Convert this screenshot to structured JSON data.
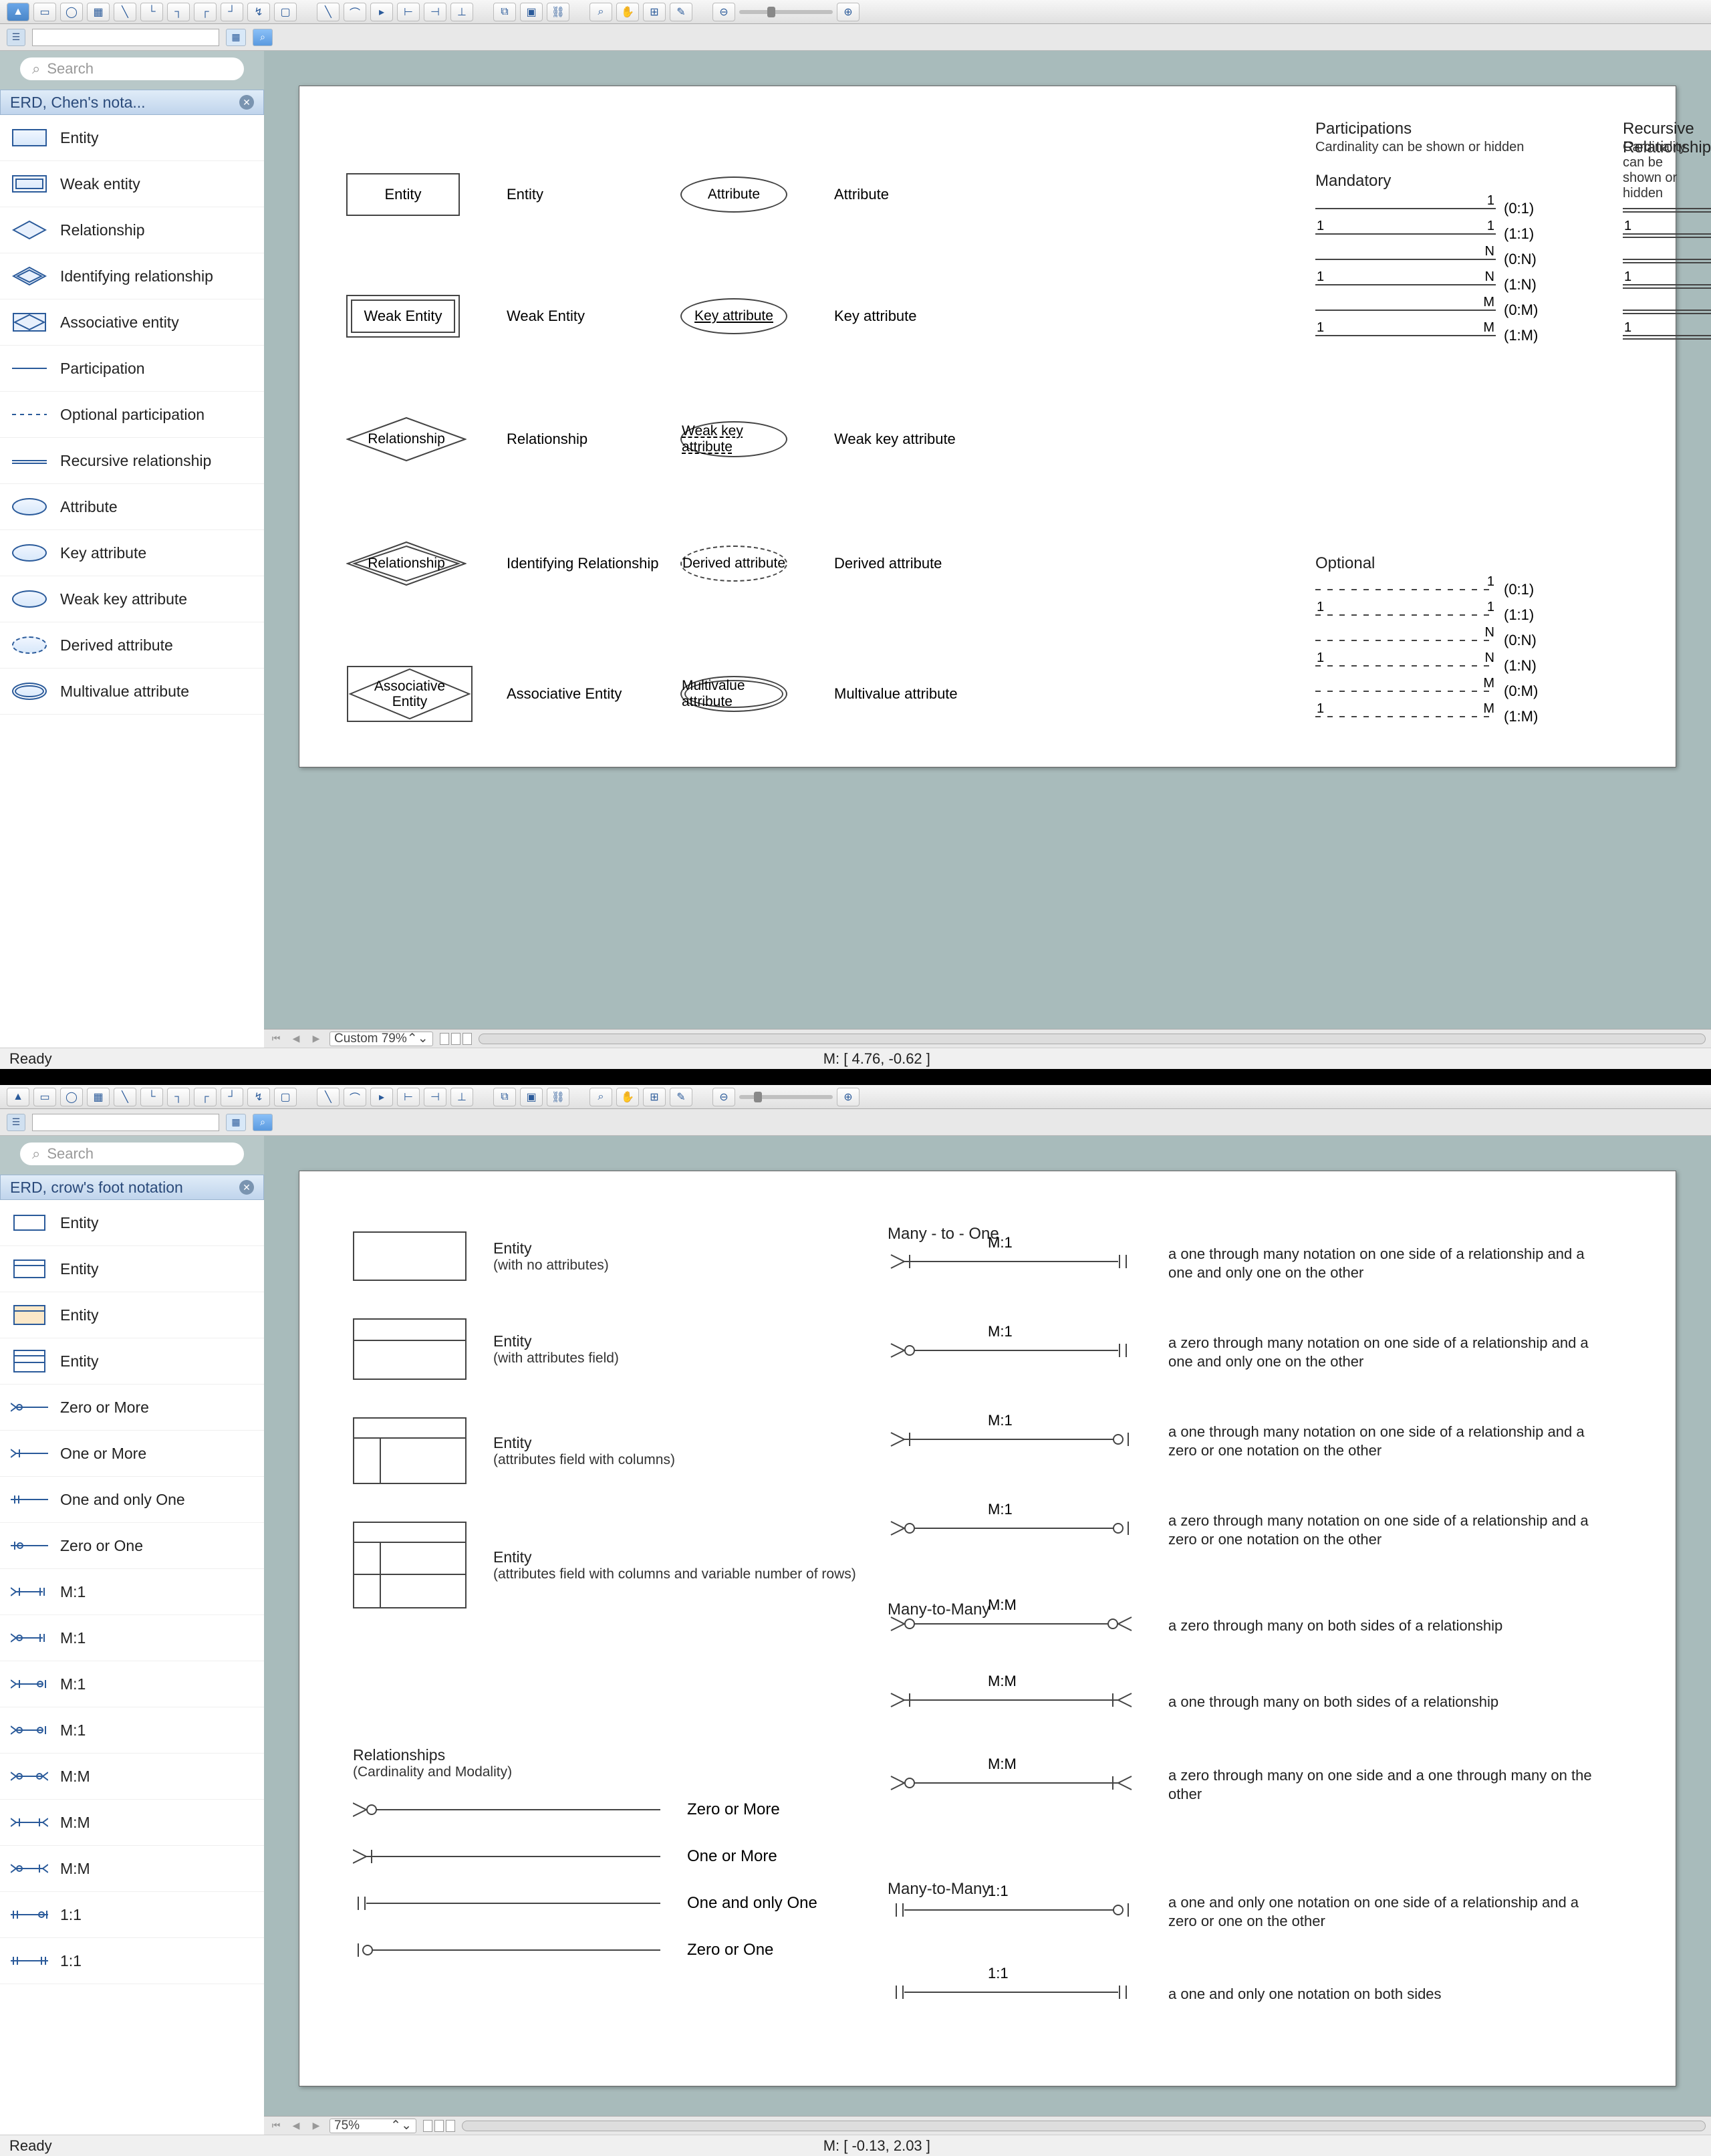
{
  "app1": {
    "toolbar_icons": [
      "pointer",
      "rect",
      "ellipse",
      "table",
      "line1",
      "corner1",
      "corner2",
      "corner3",
      "corner4",
      "connector",
      "text",
      "segment",
      "arc",
      "poly",
      "vjoin",
      "hjoin",
      "vjoin2",
      "group",
      "ungroup",
      "chain",
      "zoomin",
      "hand",
      "stamp",
      "edit",
      "zoom-out",
      "zoom-in"
    ],
    "search_placeholder": "Search",
    "panel_title": "ERD, Chen's nota...",
    "shapes": [
      {
        "label": "Entity",
        "thumb": "rect"
      },
      {
        "label": "Weak entity",
        "thumb": "rect-double"
      },
      {
        "label": "Relationship",
        "thumb": "diamond"
      },
      {
        "label": "Identifying relationship",
        "thumb": "diamond-double"
      },
      {
        "label": "Associative entity",
        "thumb": "assoc"
      },
      {
        "label": "Participation",
        "thumb": "line"
      },
      {
        "label": "Optional participation",
        "thumb": "line-dashed"
      },
      {
        "label": "Recursive relationship",
        "thumb": "line-double"
      },
      {
        "label": "Attribute",
        "thumb": "ellipse"
      },
      {
        "label": "Key attribute",
        "thumb": "ellipse"
      },
      {
        "label": "Weak key attribute",
        "thumb": "ellipse"
      },
      {
        "label": "Derived attribute",
        "thumb": "ellipse-dashed"
      },
      {
        "label": "Multivalue attribute",
        "thumb": "ellipse-double"
      }
    ],
    "canvas": {
      "entities": [
        {
          "shape": "Entity",
          "label": "Entity"
        },
        {
          "shape": "Weak Entity",
          "label": "Weak Entity"
        },
        {
          "shape": "Relationship",
          "label": "Relationship"
        },
        {
          "shape": "Relationship",
          "label": "Identifying Relationship"
        },
        {
          "shape": "Associative Entity",
          "label": "Associative Entity"
        }
      ],
      "attributes": [
        {
          "shape": "Attribute",
          "label": "Attribute"
        },
        {
          "shape": "Key attribute",
          "label": "Key attribute"
        },
        {
          "shape": "Weak key attribute",
          "label": "Weak key attribute"
        },
        {
          "shape": "Derived attribute",
          "label": "Derived attribute"
        },
        {
          "shape": "Multivalue attribute",
          "label": "Multivalue attribute"
        }
      ],
      "participations_title": "Participations",
      "participations_sub": "Cardinality can be shown or hidden",
      "recursive_title": "Recursive Relationship",
      "recursive_sub": "Cardinality can be shown or hidden",
      "mandatory_label": "Mandatory",
      "optional_label": "Optional",
      "part_rows": [
        {
          "l": "",
          "r": "1",
          "card": "(0:1)"
        },
        {
          "l": "1",
          "r": "1",
          "card": "(1:1)"
        },
        {
          "l": "",
          "r": "N",
          "card": "(0:N)"
        },
        {
          "l": "1",
          "r": "N",
          "card": "(1:N)"
        },
        {
          "l": "",
          "r": "M",
          "card": "(0:M)"
        },
        {
          "l": "1",
          "r": "M",
          "card": "(1:M)"
        }
      ],
      "optional_rows": [
        {
          "l": "",
          "r": "1",
          "card": "(0:1)"
        },
        {
          "l": "1",
          "r": "1",
          "card": "(1:1)"
        },
        {
          "l": "",
          "r": "N",
          "card": "(0:N)"
        },
        {
          "l": "1",
          "r": "N",
          "card": "(1:N)"
        },
        {
          "l": "",
          "r": "M",
          "card": "(0:M)"
        },
        {
          "l": "1",
          "r": "M",
          "card": "(1:M)"
        }
      ]
    },
    "zoom_label": "Custom 79%",
    "status_ready": "Ready",
    "status_coords": "M: [  4.76, -0.62  ]"
  },
  "app2": {
    "search_placeholder": "Search",
    "panel_title": "ERD, crow's foot notation",
    "shapes": [
      {
        "label": "Entity",
        "thumb": "ent1"
      },
      {
        "label": "Entity",
        "thumb": "ent2"
      },
      {
        "label": "Entity",
        "thumb": "ent3"
      },
      {
        "label": "Entity",
        "thumb": "ent4"
      },
      {
        "label": "Zero or More",
        "thumb": "crow-0m"
      },
      {
        "label": "One or More",
        "thumb": "crow-1m"
      },
      {
        "label": "One and only One",
        "thumb": "crow-11"
      },
      {
        "label": "Zero or One",
        "thumb": "crow-01"
      },
      {
        "label": "M:1",
        "thumb": "crow-m1a"
      },
      {
        "label": "M:1",
        "thumb": "crow-m1b"
      },
      {
        "label": "M:1",
        "thumb": "crow-m1c"
      },
      {
        "label": "M:1",
        "thumb": "crow-m1d"
      },
      {
        "label": "M:M",
        "thumb": "crow-mma"
      },
      {
        "label": "M:M",
        "thumb": "crow-mmb"
      },
      {
        "label": "M:M",
        "thumb": "crow-mmc"
      },
      {
        "label": "1:1",
        "thumb": "crow-11a"
      },
      {
        "label": "1:1",
        "thumb": "crow-11b"
      }
    ],
    "canvas": {
      "entities": [
        {
          "title": "Entity",
          "sub": "(with no attributes)"
        },
        {
          "title": "Entity",
          "sub": "(with attributes field)"
        },
        {
          "title": "Entity",
          "sub": "(attributes field with columns)"
        },
        {
          "title": "Entity",
          "sub": "(attributes field with columns and variable number of rows)"
        }
      ],
      "rel_section_title": "Relationships",
      "rel_section_sub": "(Cardinality and Modality)",
      "cardinalities": [
        {
          "name": "Zero or More",
          "symbol": "0m"
        },
        {
          "name": "One or More",
          "symbol": "1m"
        },
        {
          "name": "One and only One",
          "symbol": "11"
        },
        {
          "name": "Zero or One",
          "symbol": "01"
        }
      ],
      "mto_title": "Many - to - One",
      "mto": [
        {
          "label": "M:1",
          "left": "1m",
          "right": "11",
          "desc": "a one through many notation on one side of a relationship and a one and only one on the other"
        },
        {
          "label": "M:1",
          "left": "0m",
          "right": "11",
          "desc": "a zero through many notation on one side of a relationship and a one and only one on the other"
        },
        {
          "label": "M:1",
          "left": "1m",
          "right": "01",
          "desc": "a one through many notation on one side of a relationship and a zero or one notation on the other"
        },
        {
          "label": "M:1",
          "left": "0m",
          "right": "01",
          "desc": "a zero through many notation on one side of a relationship and a zero or one notation on the other"
        }
      ],
      "mtm_title": "Many-to-Many",
      "mtm": [
        {
          "label": "M:M",
          "left": "0m",
          "right": "0m-r",
          "desc": "a zero through many on both sides of a relationship"
        },
        {
          "label": "M:M",
          "left": "1m",
          "right": "1m-r",
          "desc": "a one through many on both sides of a relationship"
        },
        {
          "label": "M:M",
          "left": "0m",
          "right": "1m-r",
          "desc": "a zero through many on one side and a one through many on the other"
        }
      ],
      "oto_title": "Many-to-Many",
      "oto": [
        {
          "label": "1:1",
          "left": "11l",
          "right": "01",
          "desc": "a one and only one notation on one side of a relationship and a zero or one on the other"
        },
        {
          "label": "1:1",
          "left": "11l",
          "right": "11",
          "desc": "a one and only one notation on both sides"
        }
      ]
    },
    "zoom_label": "75%",
    "status_ready": "Ready",
    "status_coords": "M: [  -0.13, 2.03  ]"
  }
}
